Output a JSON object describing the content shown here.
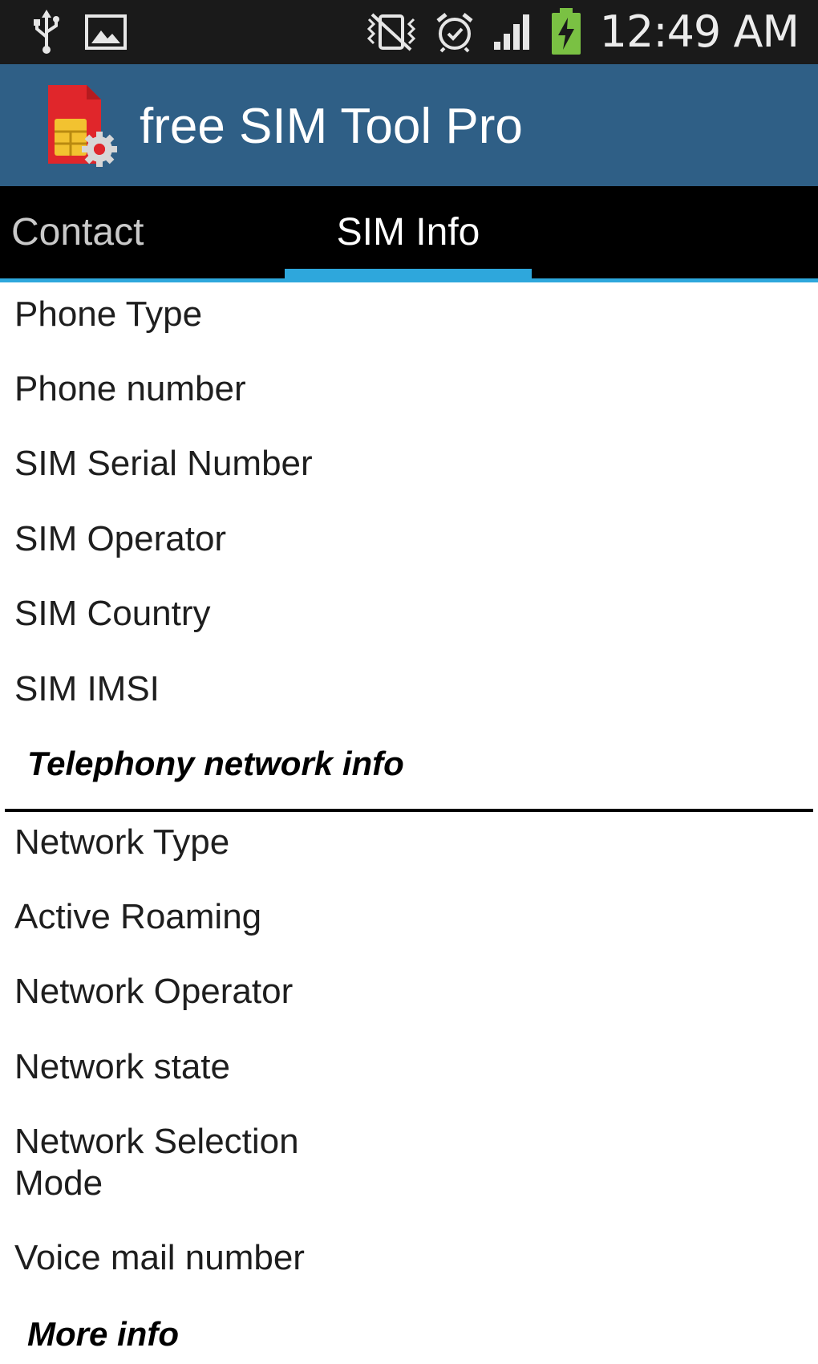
{
  "status_bar": {
    "time": "12:49 AM",
    "icons": [
      "usb-icon",
      "image-icon",
      "vibrate-icon",
      "alarm-icon",
      "signal-icon",
      "battery-charging-icon"
    ],
    "battery_color": "#7ac143"
  },
  "app_bar": {
    "title": "free SIM Tool Pro",
    "background": "#2f5f86",
    "logo": "sim-card-gear-icon"
  },
  "tabs": {
    "items": [
      {
        "label": "Contact",
        "selected": false
      },
      {
        "label": "SIM Info",
        "selected": true
      }
    ],
    "accent": "#2ea7dc"
  },
  "sim_info": {
    "rows": [
      "Phone Type",
      "Phone number",
      "SIM Serial Number",
      "SIM Operator",
      "SIM Country",
      "SIM IMSI"
    ]
  },
  "telephony": {
    "header": "Telephony network info",
    "rows": [
      "Network Type",
      "Active Roaming",
      "Network Operator",
      "Network state",
      "Network Selection Mode",
      "Voice mail number"
    ]
  },
  "more_info": {
    "header": "More info"
  }
}
